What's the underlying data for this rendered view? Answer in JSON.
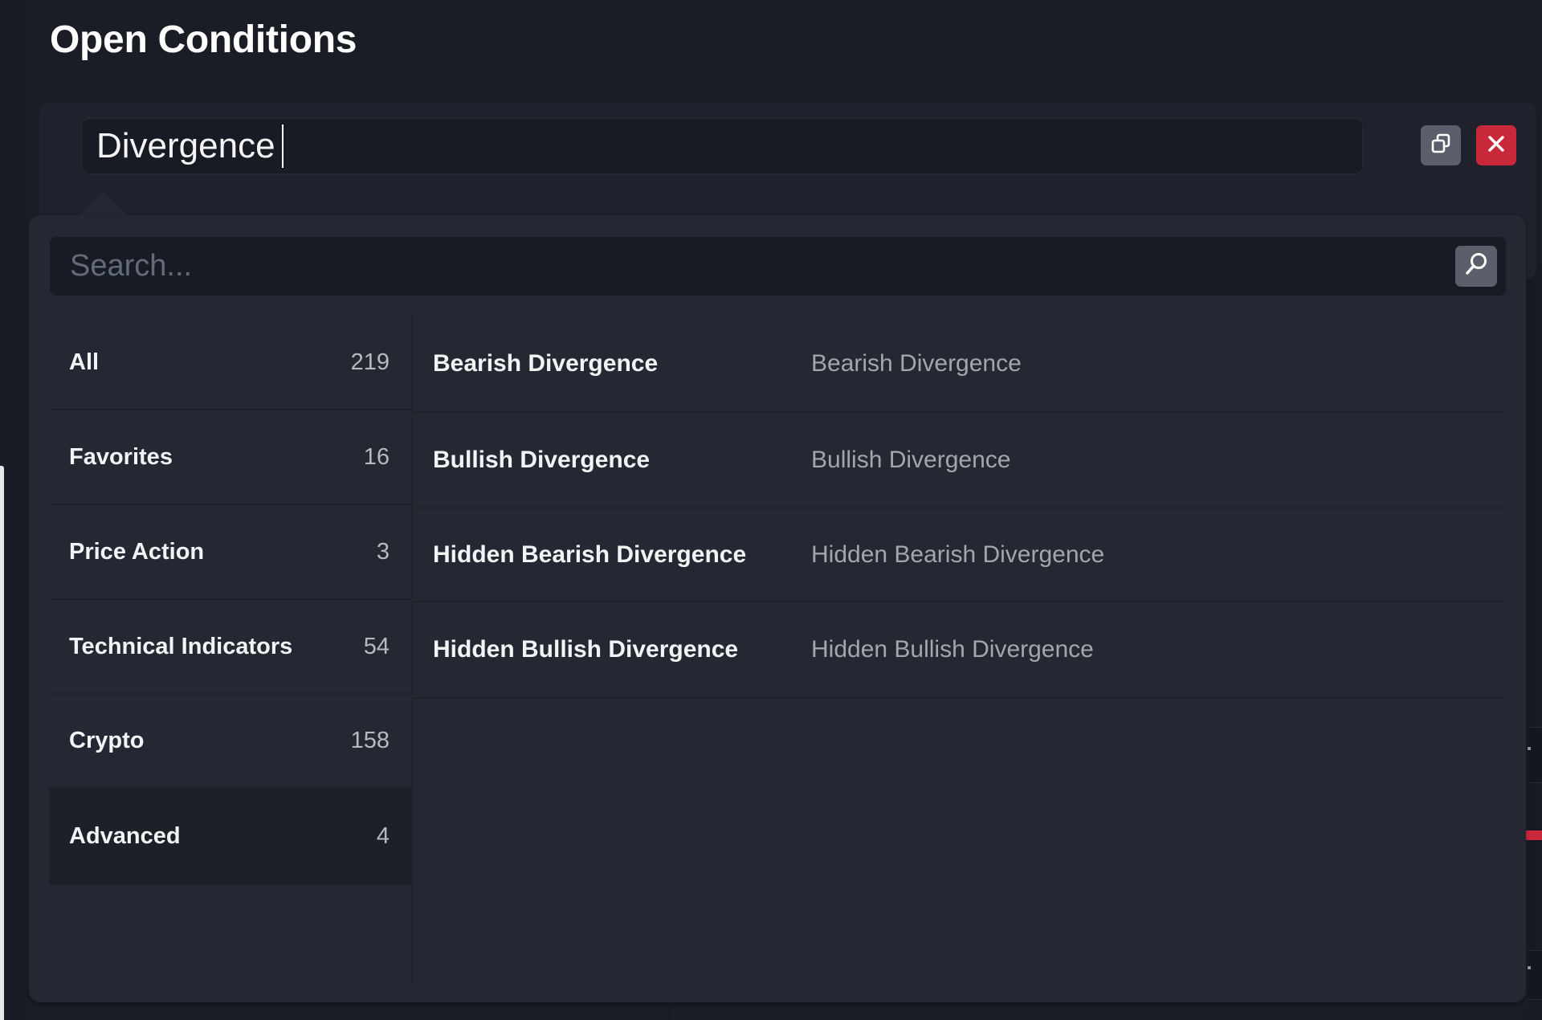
{
  "page": {
    "title": "Open Conditions"
  },
  "condition": {
    "input_value": "Divergence",
    "copy_icon": "duplicate-icon",
    "close_icon": "close-icon"
  },
  "colors": {
    "close_button": "#c8283a",
    "icon_button": "#5c5f6b"
  },
  "dropdown": {
    "search": {
      "placeholder": "Search...",
      "value": "",
      "icon": "search-icon"
    },
    "categories": [
      {
        "label": "All",
        "count": "219",
        "selected": false
      },
      {
        "label": "Favorites",
        "count": "16",
        "selected": false
      },
      {
        "label": "Price Action",
        "count": "3",
        "selected": false
      },
      {
        "label": "Technical Indicators",
        "count": "54",
        "selected": false
      },
      {
        "label": "Crypto",
        "count": "158",
        "selected": false
      },
      {
        "label": "Advanced",
        "count": "4",
        "selected": true
      }
    ],
    "results": [
      {
        "name": "Bearish Divergence",
        "description": "Bearish Divergence"
      },
      {
        "name": "Bullish Divergence",
        "description": "Bullish Divergence"
      },
      {
        "name": "Hidden Bearish Divergence",
        "description": "Hidden Bearish Divergence"
      },
      {
        "name": "Hidden Bullish Divergence",
        "description": "Hidden Bullish Divergence"
      }
    ]
  }
}
